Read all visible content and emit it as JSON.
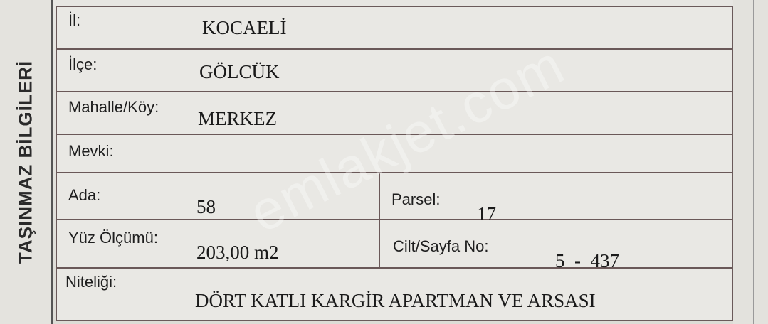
{
  "side_title": "TAŞINMAZ BİLGİLERİ",
  "fields": {
    "il": {
      "label": "İl:",
      "value": "KOCAELİ"
    },
    "ilce": {
      "label": "İlçe:",
      "value": "GÖLCÜK"
    },
    "mahalle": {
      "label": "Mahalle/Köy:",
      "value": "MERKEZ"
    },
    "mevki": {
      "label": "Mevki:",
      "value": ""
    },
    "ada": {
      "label": "Ada:",
      "value": "58"
    },
    "parsel": {
      "label": "Parsel:",
      "value": "17"
    },
    "yuz_olcumu": {
      "label": "Yüz Ölçümü:",
      "value": "203,00 m2"
    },
    "cilt_sayfa": {
      "label": "Cilt/Sayfa No:",
      "value": "5  -  437"
    },
    "niteligi": {
      "label": "Niteliği:",
      "value": "DÖRT KATLI KARGİR APARTMAN VE ARSASI"
    }
  },
  "watermark": "emlakjet.com"
}
